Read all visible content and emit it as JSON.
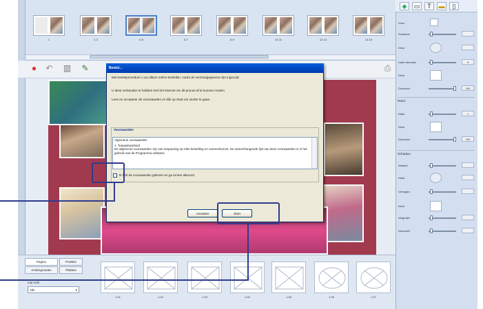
{
  "spreads": [
    {
      "label": "1",
      "blank_left": true
    },
    {
      "label": "2-3"
    },
    {
      "label": "4-5",
      "selected": true
    },
    {
      "label": "6-7"
    },
    {
      "label": "8-9"
    },
    {
      "label": "10-11"
    },
    {
      "label": "12-13"
    },
    {
      "label": "14-15"
    }
  ],
  "dialog": {
    "title": "Bestel...",
    "paragraph_1": "Met bestelprocedure u uw album online bestellen, zodra de verzendgegevens zijn ingevuld.",
    "paragraph_2": "U dient verbonden te hebben met het Internet om dit proces af te kunnen ronden.",
    "paragraph_3": "Lees en accepteer de voorwaarden en klik op Start om verder te gaan.",
    "group_title": "Voorwaarden",
    "terms_line_1": "Algemene voorwaarden",
    "terms_line_2": "1. Toepasbaarheid",
    "terms_line_3": "De algemene voorwaarden zijn van toepassing op elke bestelling en overeenkomst. De samenhangende lijst van deze voorwaarden is in het gebruik van de Programma software.",
    "checkbox_label": "Ik heb de voorwaarden gelezen en ga ermee akkoord",
    "cancel_label": "Annuleer",
    "start_label": "Start"
  },
  "right_panel": {
    "rows_top": [
      {
        "label": "Vorm"
      },
      {
        "label": "Schaduw"
      },
      {
        "label": "Kleur"
      },
      {
        "label": "Hoek afronden",
        "value": "0"
      },
      {
        "label": "Kleur"
      },
      {
        "label": "Doorzicht",
        "value": "100"
      }
    ],
    "section_rand": "Rand",
    "rows_rand": [
      {
        "label": "Dikte",
        "value": "1"
      },
      {
        "label": "Kleur"
      },
      {
        "label": "Doorzicht",
        "value": "100"
      }
    ],
    "section_schaduw": "Schaduw",
    "rows_schaduw": [
      {
        "label": "Afstand"
      },
      {
        "label": "Hoek"
      },
      {
        "label": "Vervagen"
      },
      {
        "label": "Kleur"
      },
      {
        "label": "Vergroten"
      },
      {
        "label": "Doorzicht"
      }
    ]
  },
  "bottom_panel": {
    "tab_pagina": "Pagina",
    "tab_posities": "Posities",
    "tab_achtergronden": "Achtergronden",
    "tab_plakken": "Plakken",
    "select_caption": "Lay-outs",
    "select_value": "Alle",
    "layouts": [
      {
        "label": "1-01"
      },
      {
        "label": "1-02"
      },
      {
        "label": "1-03"
      },
      {
        "label": "1-04"
      },
      {
        "label": "1-05"
      },
      {
        "label": "1-06"
      },
      {
        "label": "1-07"
      }
    ]
  },
  "colors": {
    "accent": "#0a5fdc",
    "callout": "#2d3a8c",
    "page_bg": "#a13a4f"
  }
}
